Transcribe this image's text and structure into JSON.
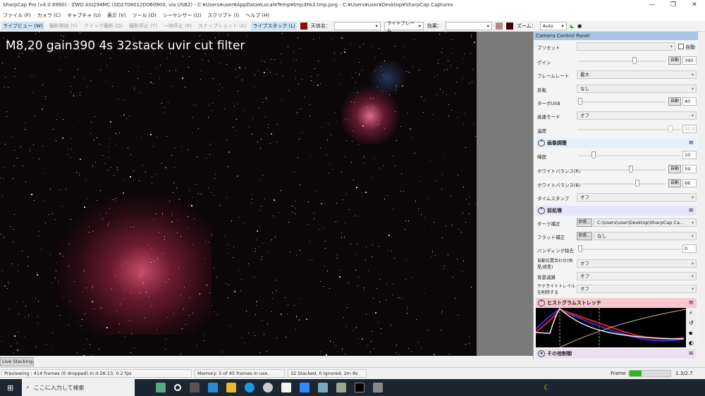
{
  "window": {
    "title": "SharpCap Pro (v4.0.8990) - ZWO ASI294MC (0D2708012D060900, via USB2) - C:¥Users¥user¥AppData¥Local¥Temp¥tmp3FA3.tmp.png - C:¥Users¥user¥Desktop¥SharpCap Captures",
    "minimize": "—",
    "maximize": "❐",
    "close": "✕"
  },
  "menu": [
    "ファイル (F)",
    "カメラ (C)",
    "キャプチャ (U)",
    "表示 (V)",
    "ツール (O)",
    "シーケンサー (U)",
    "スクリプト (I)",
    "ヘルプ (H)"
  ],
  "toolbar": {
    "live_view": "ライブビュー (W)",
    "start_capture": "撮影開始 (S)",
    "quick_capture": "クイック撮影 (Q)",
    "stop_capture": "撮影停止 (T)",
    "pause": "一時停止 (P)",
    "snapshot": "スナップショット (A)",
    "live_stack": "ライブスタック (L)",
    "target_label": "天体名：",
    "target_value": "",
    "frame_type": "ライトフレーム",
    "effect_label": "効果：",
    "effect_value": "",
    "zoom_label": "ズーム：",
    "zoom_value": "Auto"
  },
  "image": {
    "caption": "M8,20 gain390 4s 32stack uvir cut filter"
  },
  "panel": {
    "title": "Camera Control Panel",
    "preset_label": "プリセット",
    "auto_label": "自動",
    "gain": {
      "label": "ゲイン",
      "value": "390",
      "auto": "自動",
      "fraction": 0.62
    },
    "framerate": {
      "label": "フレームレート",
      "value": "最大"
    },
    "flip": {
      "label": "反転",
      "value": "なし"
    },
    "turbo": {
      "label": "ターボUSB",
      "value": "40",
      "auto": "自動",
      "fraction": 0.0
    },
    "highspeed": {
      "label": "高速モード",
      "value": "オフ"
    },
    "temp": {
      "label": "温度",
      "value": "33.0",
      "fraction": 0.88
    },
    "image_adjust": {
      "title": "画像調整",
      "brightness": {
        "label": "輝度",
        "value": "10",
        "fraction": 0.13
      },
      "wb_r": {
        "label": "ホワイトバランス(R)",
        "value": "59",
        "auto": "自動",
        "fraction": 0.58
      },
      "wb_b": {
        "label": "ホワイトバランス(B)",
        "value": "66",
        "auto": "自動",
        "fraction": 0.65
      },
      "timestamp": {
        "label": "タイムスタンプ",
        "value": "オフ"
      }
    },
    "preprocess": {
      "title": "前処理",
      "dark": {
        "label": "ダーク補正",
        "browse": "参照...",
        "value": "C:\\Users\\user\\Desktop\\SharpCap Ca..."
      },
      "flat": {
        "label": "フラット補正",
        "browse": "参照...",
        "value": "なし"
      },
      "banding": {
        "label": "バンディング除去",
        "value": "0",
        "fraction": 0.0
      },
      "align": {
        "label": "自動位置合わせ(恒星/惑星)",
        "value": "オフ"
      },
      "bgsub": {
        "label": "背景減算",
        "value": "オフ"
      },
      "satellite": {
        "label": "サテライトトレイルを削除する",
        "value": "オフ"
      }
    },
    "histogram": {
      "title": "ヒストグラムストレッチ"
    },
    "other": {
      "title": "その他制御"
    }
  },
  "live_tab": "Live Stacking",
  "status": {
    "preview": "Previewing : 414 frames (0 dropped) in 0:26:13, 0.2 fps",
    "memory": "Memory: 5 of 45 frames in use.",
    "stacked": "32 Stacked, 0 Ignored, 2m 8s",
    "frame_label": "Frame :",
    "frame_value": "1.3/2.7",
    "frame_progress": 0.3
  },
  "taskbar": {
    "search_placeholder": "ここに入力して検索"
  },
  "colors": {
    "accent": "#a8c6e2",
    "histogram_header": "#f7c8d0",
    "progress": "#22bb22"
  }
}
